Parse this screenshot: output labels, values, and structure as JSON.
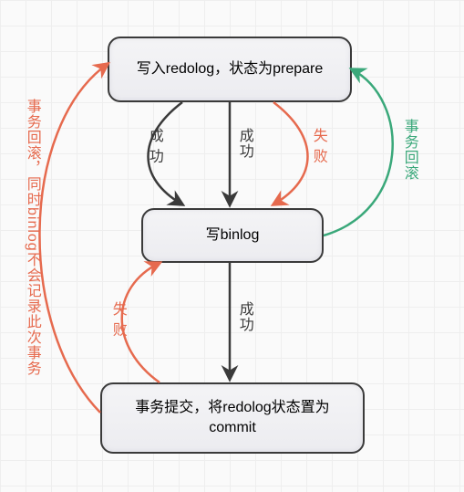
{
  "nodes": {
    "n1": "写入redolog，状态为prepare",
    "n2": "写binlog",
    "n3": "事务提交，将redolog状态置为commit"
  },
  "edges": {
    "success_a": "成 功",
    "success_b": "成功",
    "success_c": "成功",
    "fail_a": "失 败",
    "fail_b": "失 败",
    "rollback_right": "事务回滚",
    "rollback_left": "事务回滚，同时binlog不会记录此次事务"
  }
}
